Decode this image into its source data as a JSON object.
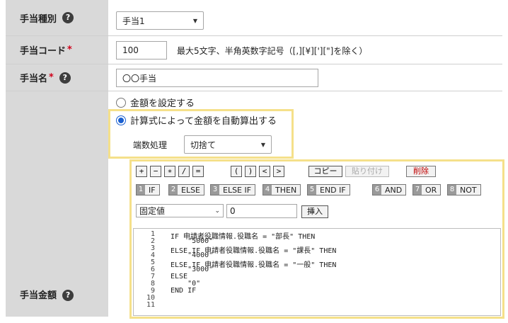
{
  "fields": {
    "allowance_type": {
      "label": "手当種別",
      "value": "手当1"
    },
    "allowance_code": {
      "label": "手当コード",
      "required_mark": "*",
      "value": "100",
      "hint": "最大5文字、半角英数字記号（[,][¥]['][\"]を除く）"
    },
    "allowance_name": {
      "label": "手当名",
      "required_mark": "*",
      "value": "〇〇手当"
    },
    "allowance_amount": {
      "label": "手当金額"
    }
  },
  "help_icon": "?",
  "amount_options": {
    "set_amount": "金額を設定する",
    "auto_calc": "計算式によって金額を自動算出する",
    "rounding_label": "端数処理",
    "rounding_value": "切捨て"
  },
  "toolbar": {
    "op_buttons": [
      "+",
      "−",
      "∗",
      "/",
      "=",
      "(",
      ")",
      "<",
      ">"
    ],
    "copy": "コピー",
    "paste": "貼り付け",
    "delete": "削除"
  },
  "keywords": [
    {
      "num": "1",
      "label": "IF"
    },
    {
      "num": "2",
      "label": "ELSE"
    },
    {
      "num": "3",
      "label": "ELSE IF"
    },
    {
      "num": "4",
      "label": "THEN"
    },
    {
      "num": "5",
      "label": "END IF"
    },
    {
      "num": "6",
      "label": "AND"
    },
    {
      "num": "7",
      "label": "OR"
    },
    {
      "num": "8",
      "label": "NOT"
    }
  ],
  "insert_row": {
    "select_value": "固定値",
    "input_value": "0",
    "insert_label": "挿入"
  },
  "code_lines": [
    "IF 申請者役職情報.役職名 = \"部長\" THEN",
    "    \"5000\"",
    "ELSE IF 申請者役職情報.役職名 = \"課長\" THEN",
    "    \"4000\"",
    "ELSE IF 申請者役職情報.役職名 = \"一般\" THEN",
    "    \"3000\"",
    "ELSE",
    "    \"0\"",
    "END IF",
    "",
    ""
  ],
  "line_numbers": [
    "1",
    "2",
    "3",
    "4",
    "5",
    "6",
    "7",
    "8",
    "9",
    "10",
    "11"
  ],
  "colors": {
    "label_bg": "#d9d9d9",
    "highlight": "#f5e08a",
    "required": "#d0021b",
    "radio": "#1a5fd0"
  }
}
